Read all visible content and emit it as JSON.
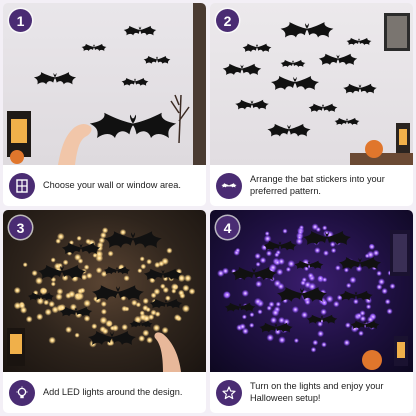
{
  "steps": [
    {
      "number": "1",
      "text": "Choose your wall or window area.",
      "icon": "window-icon"
    },
    {
      "number": "2",
      "text": "Arrange the bat stickers into your preferred pattern.",
      "icon": "bat-icon"
    },
    {
      "number": "3",
      "text": "Add LED lights around the design.",
      "icon": "lightbulb-icon"
    },
    {
      "number": "4",
      "text": "Turn on the lights and enjoy your Halloween setup!",
      "icon": "star-icon"
    }
  ],
  "colors": {
    "accent": "#4a2c73",
    "glow_warm": "#ffd98a",
    "glow_purple": "#b57bff"
  }
}
